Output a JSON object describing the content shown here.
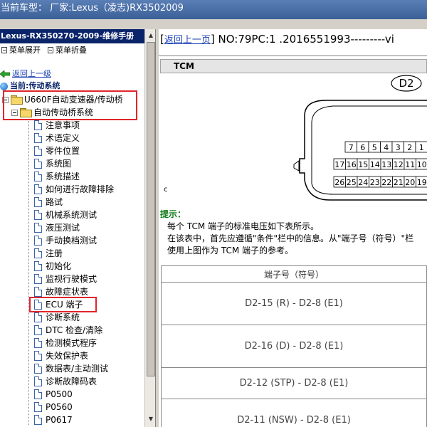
{
  "window": {
    "title": "当前车型：  厂家:Lexus（凌志)RX3502009"
  },
  "left": {
    "header": "Lexus-RX350270-2009-维修手册",
    "toolbar": {
      "expand_label": "菜单展开",
      "collapse_label": "菜单折叠"
    },
    "back_link": "返回上一级",
    "current": "当前:传动系统",
    "folders": [
      "U660F自动变速器/传动桥",
      "自动传动桥系统"
    ],
    "items": [
      "注意事项",
      "术语定义",
      "零件位置",
      "系统图",
      "系统描述",
      "如何进行故障排除",
      "路试",
      "机械系统测试",
      "液压测试",
      "手动换档测试",
      "注册",
      "初始化",
      "监视行驶模式",
      "故障症状表",
      "ECU 端子",
      "诊断系统",
      "DTC 检查/清除",
      "检测模式程序",
      "失效保护表",
      "数据表/主动测试",
      "诊断故障码表",
      "P0500",
      "P0560",
      "P0617"
    ]
  },
  "right": {
    "back_link": "返回上一页",
    "doc_id": "NO:79PC:1 .2016551993---------vi",
    "section_title": "TCM",
    "connector": {
      "name": "D2",
      "row1": [
        "7",
        "6",
        "5",
        "4",
        "3",
        "2",
        "1"
      ],
      "row2": [
        "17",
        "16",
        "15",
        "14",
        "13",
        "12",
        "11",
        "10"
      ],
      "row3": [
        "26",
        "25",
        "24",
        "23",
        "22",
        "21",
        "20",
        "19"
      ],
      "side_label": "c"
    },
    "tip": {
      "title": "提示：",
      "lines": [
        "每个 TCM 端子的标准电压如下表所示。",
        "在该表中，首先应遵循\"条件\"栏中的信息。从\"端子号（符号）\"栏",
        "使用上图作为 TCM 端子的参考。"
      ]
    },
    "table": {
      "header": "端子号（符号）",
      "rows": [
        "D2-15 (R) - D2-8 (E1)",
        "D2-16 (D) - D2-8 (E1)",
        "D2-12 (STP) - D2-8 (E1)",
        "D2-11 (NSW) - D2-8 (E1)"
      ]
    }
  },
  "colors": {
    "titlebar": "#4a6fa5",
    "left_header": "#0a246a",
    "highlight_box": "#e0262b",
    "tip_title": "#0a7a12",
    "link": "#1a3fb5"
  }
}
